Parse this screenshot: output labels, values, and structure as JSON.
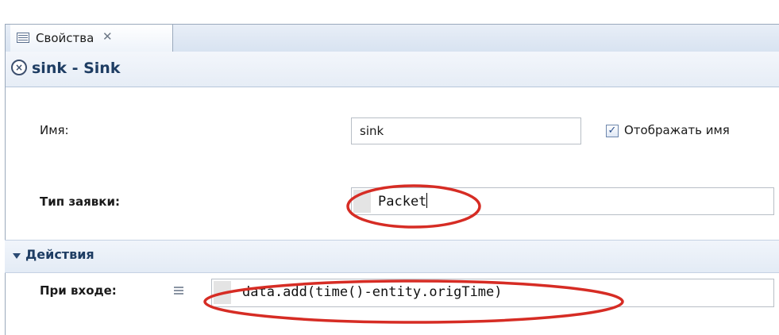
{
  "tab": {
    "label": "Свойства",
    "close_glyph": "✕",
    "icon": "properties-table-icon"
  },
  "header": {
    "title": "sink - Sink",
    "icon": "close-circle-icon"
  },
  "fields": {
    "name": {
      "label": "Имя:",
      "value": "sink"
    },
    "show_name": {
      "label": "Отображать имя",
      "checked": true,
      "glyph": "✓"
    },
    "entity_type": {
      "label": "Тип заявки:",
      "value": "Packet"
    }
  },
  "section": {
    "label": "Действия",
    "expanded": true
  },
  "actions": {
    "on_enter": {
      "label": "При входе:",
      "value": "data.add(time()-entity.origTime)",
      "icon": "menu-lines-icon"
    }
  },
  "colors": {
    "accent": "#1e3d63",
    "highlight_ellipse": "#d62c24"
  }
}
